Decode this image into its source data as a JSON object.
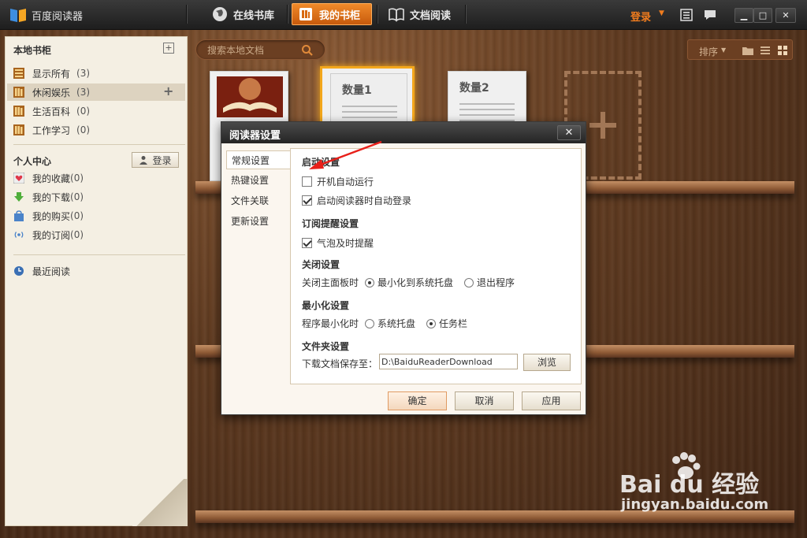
{
  "app": {
    "title": "百度阅读器"
  },
  "nav": {
    "tabs": [
      {
        "label": "在线书库",
        "active": false
      },
      {
        "label": "我的书柜",
        "active": true
      },
      {
        "label": "文档阅读",
        "active": false
      }
    ]
  },
  "topbar": {
    "login_label": "登录"
  },
  "window_controls": {
    "minimize": "▁",
    "maximize": "□",
    "close": "✕"
  },
  "sidebar": {
    "local_title": "本地书柜",
    "add_label": "+",
    "local_items": [
      {
        "label": "显示所有",
        "count": "(3)"
      },
      {
        "label": "休闲娱乐",
        "count": "(3)",
        "selected": true
      },
      {
        "label": "生活百科",
        "count": "(0)"
      },
      {
        "label": "工作学习",
        "count": "(0)"
      }
    ],
    "personal_title": "个人中心",
    "login_button": "登录",
    "personal_items": [
      {
        "label": "我的收藏",
        "count": "(0)"
      },
      {
        "label": "我的下载",
        "count": "(0)"
      },
      {
        "label": "我的购买",
        "count": "(0)"
      },
      {
        "label": "我的订阅",
        "count": "(0)"
      }
    ],
    "recent_label": "最近阅读"
  },
  "search": {
    "placeholder": "搜索本地文档"
  },
  "toolbar": {
    "sort_label": "排序"
  },
  "books": [
    {
      "title": ""
    },
    {
      "title": "数量1"
    },
    {
      "title": "数量2"
    }
  ],
  "dialog": {
    "title": "阅读器设置",
    "close": "✕",
    "nav": [
      "常规设置",
      "热键设置",
      "文件关联",
      "更新设置"
    ],
    "sections": {
      "startup": {
        "title": "启动设置",
        "auto_run": {
          "label": "开机自动运行",
          "checked": false
        },
        "auto_login": {
          "label": "启动阅读器时自动登录",
          "checked": true
        }
      },
      "subscribe": {
        "title": "订阅提醒设置",
        "bubble": {
          "label": "气泡及时提醒",
          "checked": true
        }
      },
      "close": {
        "title": "关闭设置",
        "prompt": "关闭主面板时",
        "options": [
          "最小化到系统托盘",
          "退出程序"
        ],
        "selected": 0
      },
      "minimize": {
        "title": "最小化设置",
        "prompt": "程序最小化时",
        "options": [
          "系统托盘",
          "任务栏"
        ],
        "selected": 1
      },
      "folder": {
        "title": "文件夹设置",
        "prompt": "下载文档保存至：",
        "path": "D:\\BaiduReaderDownload",
        "browse": "浏览"
      }
    },
    "buttons": {
      "ok": "确定",
      "cancel": "取消",
      "apply": "应用"
    }
  },
  "watermark": {
    "brand": "Bai du 经验",
    "url": "jingyan.baidu.com"
  },
  "colors": {
    "accent": "#f07c1e",
    "active_tab": "#e07420",
    "annotation": "#e8201a"
  }
}
